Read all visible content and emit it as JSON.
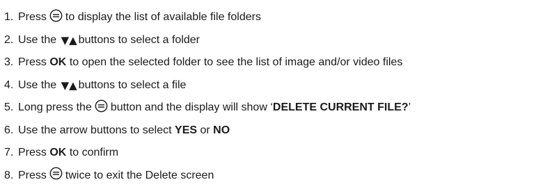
{
  "steps": [
    {
      "num": "1.",
      "a": "Press",
      "b": "to display the list of available file folders"
    },
    {
      "num": "2.",
      "a": "Use the",
      "arrows": "▼▲",
      "b": "buttons to select a folder"
    },
    {
      "num": "3.",
      "a": "Press",
      "bold": "OK",
      "b": "to open the selected folder to see the list of image and/or video files"
    },
    {
      "num": "4.",
      "a": "Use the",
      "arrows": "▼▲",
      "b": "buttons to select a file"
    },
    {
      "num": "5.",
      "a": "Long press the",
      "b": "button and the display will show ‘",
      "bold": "DELETE CURRENT FILE?",
      "c": "’"
    },
    {
      "num": "6.",
      "a": "Use the arrow buttons to select",
      "bold1": "YES",
      "mid": "or",
      "bold2": "NO"
    },
    {
      "num": "7.",
      "a": "Press",
      "bold": "OK",
      "b": "to confirm"
    },
    {
      "num": "8.",
      "a": "Press",
      "b": "twice to exit the Delete screen"
    }
  ],
  "icons": {
    "menu": "menu-button-icon"
  }
}
